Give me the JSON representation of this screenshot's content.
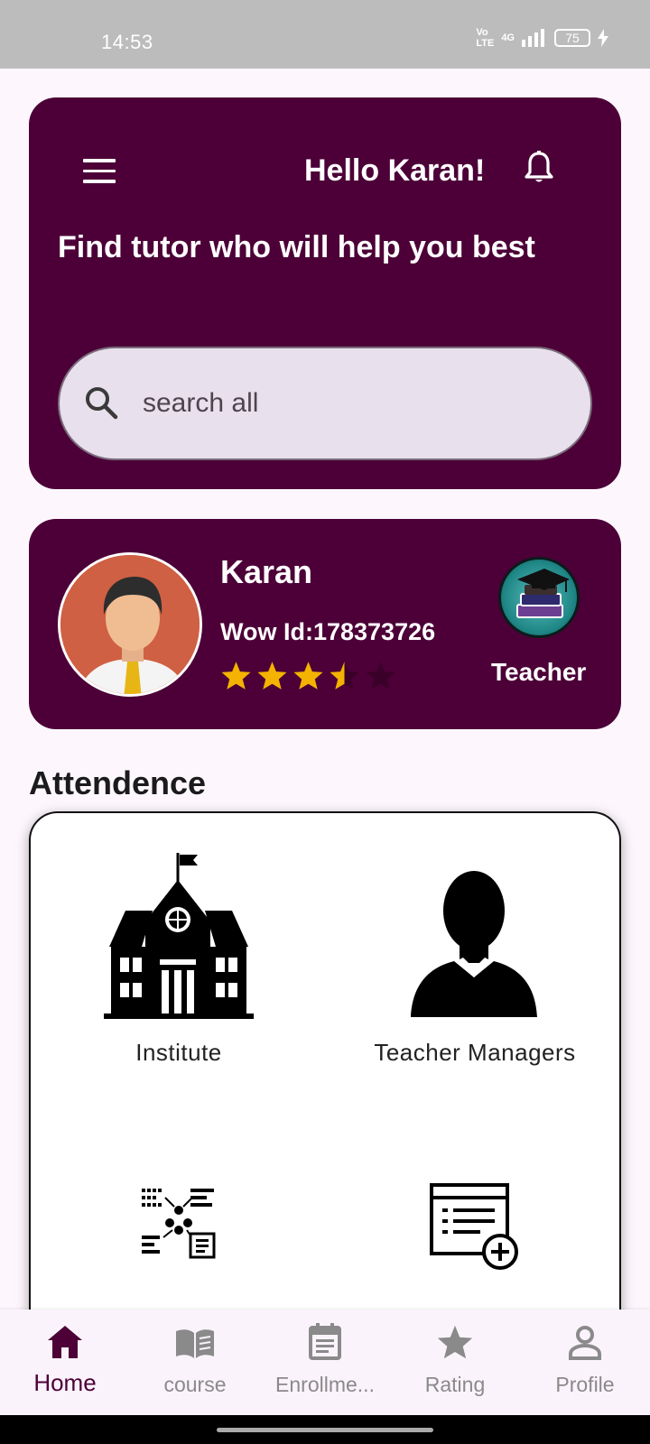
{
  "status_bar": {
    "time": "14:53",
    "network": "4G",
    "battery": "75"
  },
  "header": {
    "greeting": "Hello Karan!",
    "headline": "Find tutor who will help you best",
    "search_placeholder": "search all"
  },
  "profile": {
    "name": "Karan",
    "wow_id": "Wow Id:178373726",
    "rating": 3.5,
    "rating_max": 5,
    "role": "Teacher"
  },
  "attendance": {
    "title": "Attendence",
    "tiles": [
      {
        "label": "Institute",
        "icon": "institute-building-icon"
      },
      {
        "label": "Teacher Managers",
        "icon": "teacher-silhouette-icon"
      },
      {
        "label": "",
        "icon": "org-network-icon"
      },
      {
        "label": "",
        "icon": "add-list-icon"
      }
    ]
  },
  "bottom_nav": {
    "items": [
      {
        "label": "Home",
        "icon": "home-icon",
        "active": true
      },
      {
        "label": "course",
        "icon": "book-icon",
        "active": false
      },
      {
        "label": "Enrollme...",
        "icon": "calendar-icon",
        "active": false
      },
      {
        "label": "Rating",
        "icon": "star-icon",
        "active": false
      },
      {
        "label": "Profile",
        "icon": "person-icon",
        "active": false
      }
    ]
  },
  "colors": {
    "primary": "#4c0037",
    "star": "#f5b301",
    "background": "#fdf7fd"
  }
}
